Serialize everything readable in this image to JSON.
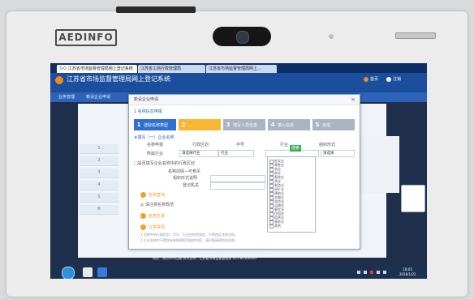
{
  "kiosk": {
    "brand": "AEDINFO"
  },
  "browser": {
    "tabs": [
      {
        "label": "ㅁㅁ 江苏省市场监督管理局网上登记系统"
      },
      {
        "label": "江苏省工商行政管理局"
      },
      {
        "label": "江苏省市场监督管理局网上…"
      }
    ]
  },
  "app": {
    "title": "江苏省市场监督管理局网上登记系统",
    "header_right": [
      "首页",
      "注销"
    ],
    "nav": [
      "业务管理",
      "新设企业申请"
    ]
  },
  "modal": {
    "title": "新设企业申请",
    "section_title": "1 名称信息申报",
    "steps": [
      {
        "num": "1",
        "label": "选取名称类型"
      },
      {
        "num": "2",
        "label": "…"
      },
      {
        "num": "3",
        "label": "填写人员信息"
      },
      {
        "num": "4",
        "label": "填入信息"
      },
      {
        "num": "5",
        "label": "完成"
      }
    ],
    "sub_heading": "★填写（一）企业名称",
    "fields": {
      "row1": [
        "名称申报",
        "行政区划",
        "字号",
        "行业",
        "组织形式"
      ],
      "row2_label": "所属行业",
      "row2_value1": "请选择行业",
      "row2_value2": "行业"
    },
    "search_placeholder": "请选择",
    "search_button": "搜索",
    "section_sub": "□是否填写企业名称中的行政区划",
    "block_labels": [
      "名称前缀—可参见",
      "组织形式说明",
      "登记机关"
    ],
    "dropdown_items": [
      "批发业",
      "零售业",
      "农业",
      "林业",
      "畜牧业",
      "渔业",
      "制造业",
      "采矿业",
      "建筑业",
      "金融业",
      "电信业",
      "运输业",
      "餐饮业",
      "住宿业",
      "租赁业",
      "服务业",
      "其他"
    ],
    "orange_items": [
      "名称查询",
      "名称主体",
      "注意事项"
    ],
    "warn_text": "◎ 请注意名称规范",
    "notes": [
      "1.名称中的行政区划、字号、行业应符合规定，不得违反法律法规。",
      "2.企业名称中不得含有有损国家利益的内容，请仔细阅读相关说明。"
    ]
  },
  "footer": {
    "line1": "© Copyright 2014 江苏省市场监督管理局 All rights reserved.",
    "line2": "地址：南京市中山路 技术支持：江苏省市场监督管理局 025-84560000"
  },
  "taskbar": {
    "time": "18:05",
    "date": "2016/1/22"
  },
  "colors": {
    "header_blue": "#1b4e9c",
    "step_active": "#2f6fd0",
    "step_done": "#f7b733",
    "step_inactive": "#aab4c4",
    "accent_green": "#36b05b",
    "accent_orange": "#f4a028"
  }
}
